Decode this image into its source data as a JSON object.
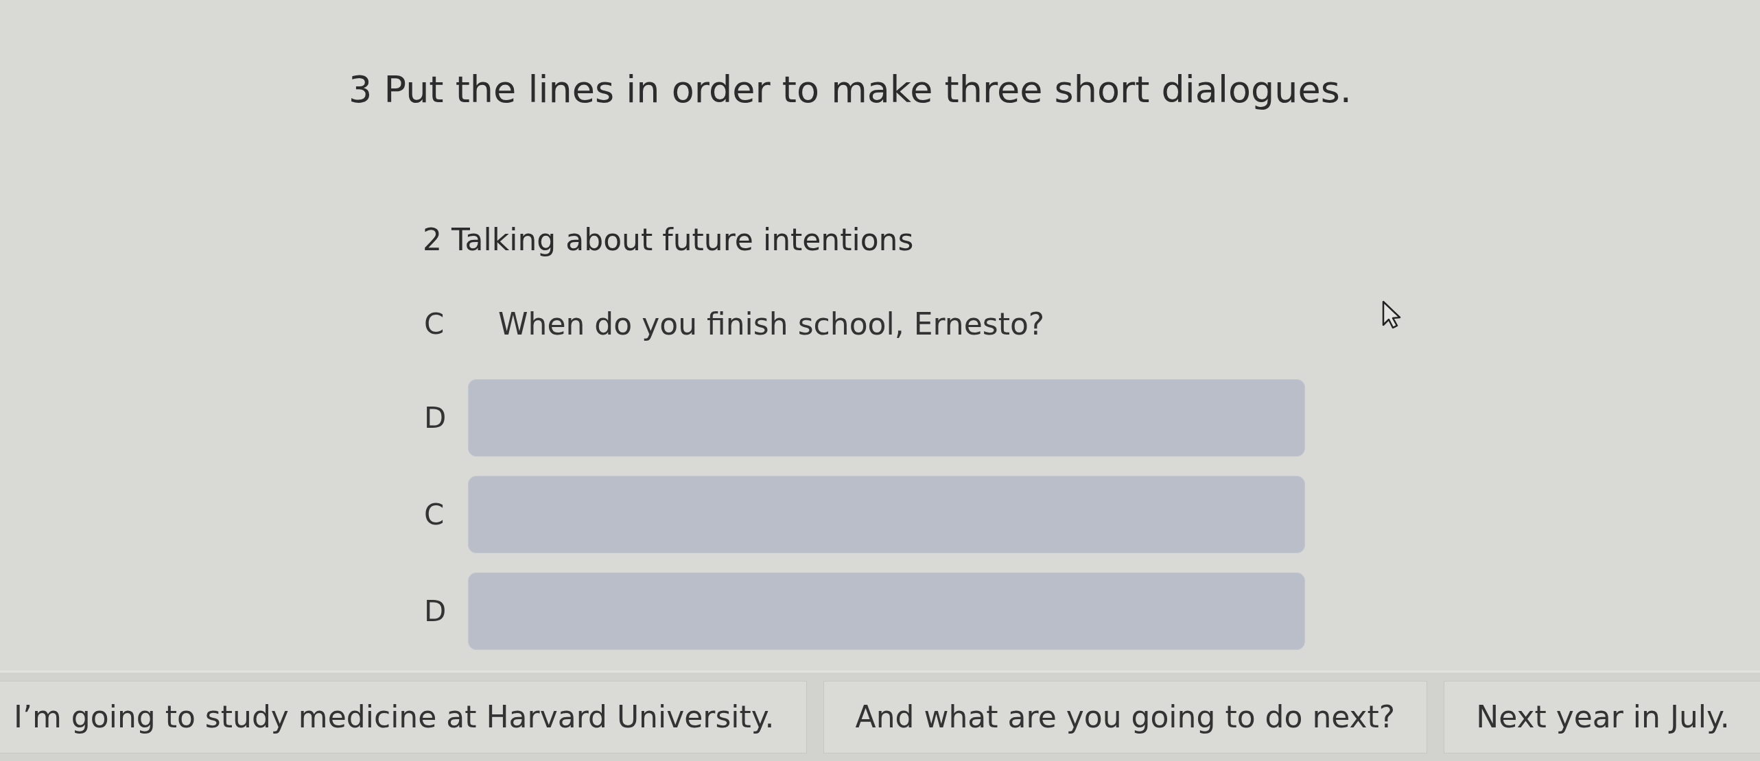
{
  "title": "3 Put the lines in order to make three short dialogues.",
  "section": {
    "heading": "2 Talking about future intentions",
    "lines": [
      {
        "speaker": "C",
        "kind": "given",
        "text": "When do you finish school, Ernesto?"
      },
      {
        "speaker": "D",
        "kind": "blank"
      },
      {
        "speaker": "C",
        "kind": "blank"
      },
      {
        "speaker": "D",
        "kind": "blank"
      }
    ]
  },
  "options": [
    "I’m going to study medicine at Harvard University.",
    "And what are you going to do next?",
    "Next year in July."
  ]
}
